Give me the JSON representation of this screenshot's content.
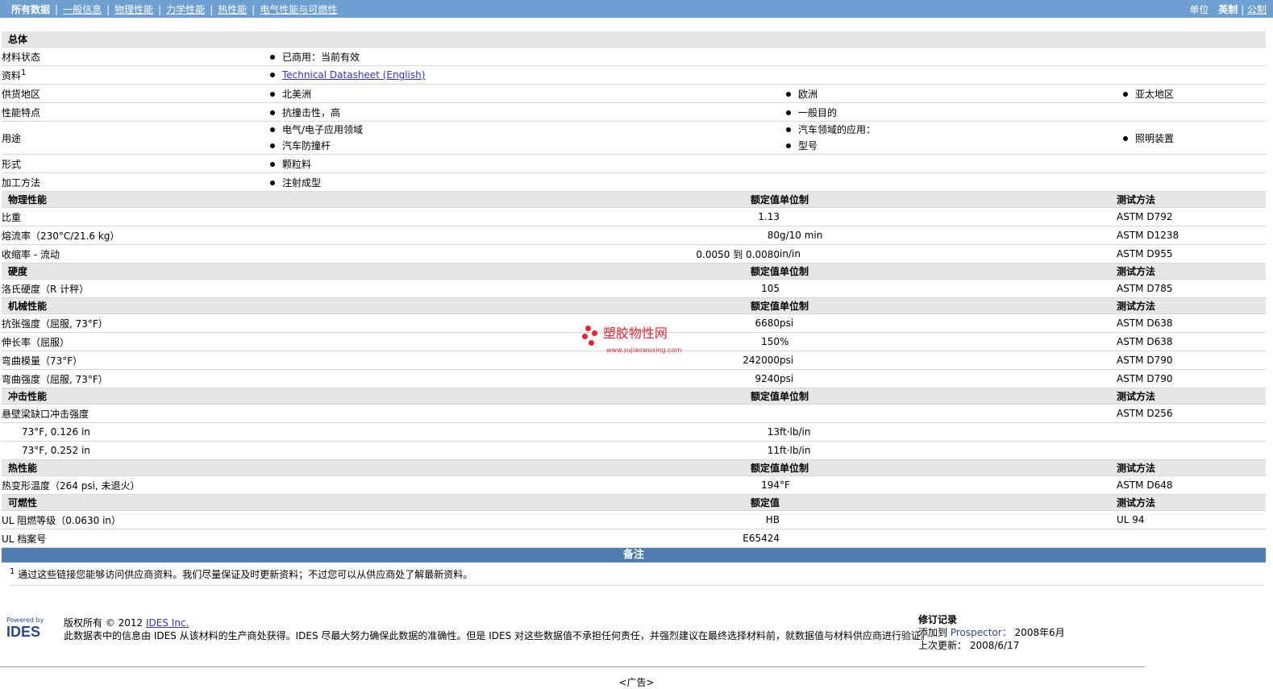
{
  "topbar": {
    "tabs": [
      "所有数据",
      "一般信息",
      "物理性能",
      "力学性能",
      "热性能",
      "电气性能与可燃性"
    ],
    "units_label": "单位",
    "unit_active": "英制",
    "unit_sep": "|",
    "unit_other": "公制"
  },
  "general": {
    "title": "总体",
    "rows": [
      {
        "name": "材料状态",
        "values": [
          [
            "已商用：当前有效"
          ]
        ]
      },
      {
        "name": "资料",
        "sup": "1",
        "link": "Technical Datasheet (English)"
      },
      {
        "name": "供货地区",
        "values": [
          [
            "北美洲"
          ],
          [
            "欧洲"
          ],
          [
            "亚太地区"
          ]
        ]
      },
      {
        "name": "性能特点",
        "values": [
          [
            "抗撞击性，高"
          ],
          [
            "一般目的"
          ]
        ]
      },
      {
        "name": "用途",
        "values": [
          [
            "电气/电子应用领域",
            "汽车防撞杆"
          ],
          [
            "汽车领域的应用：",
            "型号"
          ],
          [
            "照明装置"
          ]
        ]
      },
      {
        "name": "形式",
        "values": [
          [
            "颗粒料"
          ]
        ]
      },
      {
        "name": "加工方法",
        "values": [
          [
            "注射成型"
          ]
        ]
      }
    ]
  },
  "col_headers": {
    "value": "额定值",
    "unit": "单位制",
    "method": "测试方法"
  },
  "sections": [
    {
      "title": "物理性能",
      "rows": [
        {
          "name": "比重",
          "value": "1.13",
          "unit": "",
          "method": "ASTM D792"
        },
        {
          "name": "熔流率（230°C/21.6 kg）",
          "value": "80",
          "unit": "g/10 min",
          "method": "ASTM D1238"
        },
        {
          "name": "收缩率 - 流动",
          "value": "0.0050 到  0.0080",
          "unit": "in/in",
          "method": "ASTM D955"
        }
      ]
    },
    {
      "title": "硬度",
      "rows": [
        {
          "name": "洛氏硬度（R 计秤）",
          "value": "105",
          "unit": "",
          "method": "ASTM D785"
        }
      ]
    },
    {
      "title": "机械性能",
      "rows": [
        {
          "name": "抗张强度（屈服, 73°F）",
          "value": "6680",
          "unit": "psi",
          "method": "ASTM D638"
        },
        {
          "name": "伸长率（屈服）",
          "value": "150",
          "unit": "%",
          "method": "ASTM D638"
        },
        {
          "name": "弯曲模量（73°F）",
          "value": "242000",
          "unit": "psi",
          "method": "ASTM D790"
        },
        {
          "name": "弯曲强度（屈服, 73°F）",
          "value": "9240",
          "unit": "psi",
          "method": "ASTM D790"
        }
      ]
    },
    {
      "title": "冲击性能",
      "rows": [
        {
          "name": "悬壁梁缺口冲击强度",
          "value": "",
          "unit": "",
          "method": "ASTM D256"
        },
        {
          "name": "73°F, 0.126 in",
          "value": "13",
          "unit": "ft·lb/in",
          "method": "",
          "sub": true
        },
        {
          "name": "73°F, 0.252 in",
          "value": "11",
          "unit": "ft·lb/in",
          "method": "",
          "sub": true
        }
      ]
    },
    {
      "title": "热性能",
      "rows": [
        {
          "name": "热变形温度（264 psi, 未退火）",
          "value": "194",
          "unit": "°F",
          "method": "ASTM D648"
        }
      ]
    },
    {
      "title": "可燃性",
      "no_unit_header": true,
      "rows": [
        {
          "name": "UL 阻燃等级（0.0630 in）",
          "value": "HB",
          "unit": "",
          "method": "UL 94"
        },
        {
          "name": "UL 档案号",
          "value": "E65424",
          "unit": "",
          "method": ""
        }
      ]
    }
  ],
  "watermark": {
    "big": "塑胶物性网",
    "small": "www.sujiaowuxing.com"
  },
  "notes": {
    "title": "备注",
    "footnote_mark": "1",
    "footnote": "通过这些链接您能够访问供应商资料。我们尽量保证及时更新资料；不过您可以从供应商处了解最新资料。"
  },
  "footer": {
    "logo_powered": "Powered by",
    "logo_name": "IDES",
    "copyright_prefix": "版权所有  © 2012 ",
    "copyright_link": "IDES Inc.",
    "disclaimer": "此数据表中的信息由  IDES 从该材料的生产商处获得。IDES 尽最大努力确保此数据的准确性。但是  IDES 对这些数据值不承担任何责任，并强烈建议在最终选择材料前，就数据值与材料供应商进行验证。",
    "rev_title": "修订记录",
    "rev_added_label": "添加到",
    "rev_added_src": "Prospector：",
    "rev_added_date": "2008年6月",
    "rev_updated_label": "上次更新：",
    "rev_updated_date": "2008/6/17"
  },
  "ad": "<广告>"
}
